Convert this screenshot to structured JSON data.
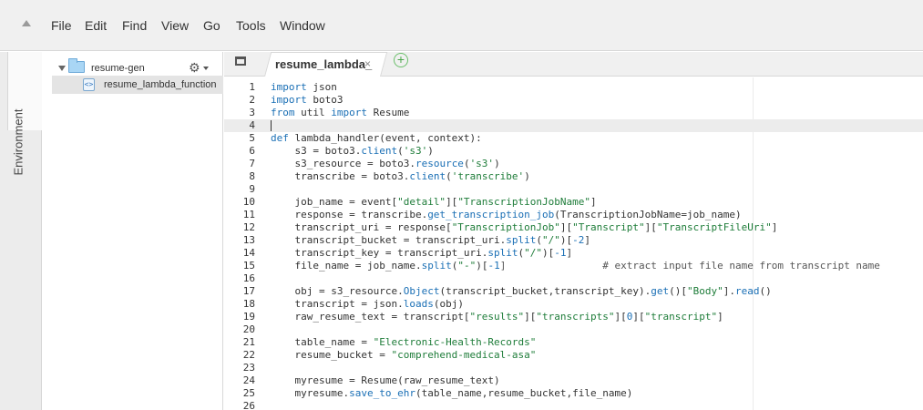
{
  "menu": {
    "items": [
      "File",
      "Edit",
      "Find",
      "View",
      "Go",
      "Tools",
      "Window"
    ]
  },
  "sidebar": {
    "environment_label": "Environment"
  },
  "tree": {
    "project_name": "resume-gen",
    "file_name": "resume_lambda_function"
  },
  "tabs": {
    "active_label": "resume_lambda_",
    "close_glyph": "×",
    "add_glyph": "+"
  },
  "editor": {
    "lines": [
      [
        {
          "t": "import",
          "c": "kw"
        },
        {
          "t": " json"
        }
      ],
      [
        {
          "t": "import",
          "c": "kw"
        },
        {
          "t": " boto3"
        }
      ],
      [
        {
          "t": "from",
          "c": "kw"
        },
        {
          "t": " util "
        },
        {
          "t": "import",
          "c": "kw"
        },
        {
          "t": " Resume"
        }
      ],
      [],
      [
        {
          "t": "def",
          "c": "kw"
        },
        {
          "t": " lambda_handler(event, context):"
        }
      ],
      [
        {
          "t": "    s3 = boto3."
        },
        {
          "t": "client",
          "c": "fn"
        },
        {
          "t": "("
        },
        {
          "t": "'s3'",
          "c": "str"
        },
        {
          "t": ")"
        }
      ],
      [
        {
          "t": "    s3_resource = boto3."
        },
        {
          "t": "resource",
          "c": "fn"
        },
        {
          "t": "("
        },
        {
          "t": "'s3'",
          "c": "str"
        },
        {
          "t": ")"
        }
      ],
      [
        {
          "t": "    transcribe = boto3."
        },
        {
          "t": "client",
          "c": "fn"
        },
        {
          "t": "("
        },
        {
          "t": "'transcribe'",
          "c": "str"
        },
        {
          "t": ")"
        }
      ],
      [],
      [
        {
          "t": "    job_name = event["
        },
        {
          "t": "\"detail\"",
          "c": "str"
        },
        {
          "t": "]["
        },
        {
          "t": "\"TranscriptionJobName\"",
          "c": "str"
        },
        {
          "t": "]"
        }
      ],
      [
        {
          "t": "    response = transcribe."
        },
        {
          "t": "get_transcription_job",
          "c": "fn"
        },
        {
          "t": "(TranscriptionJobName=job_name)"
        }
      ],
      [
        {
          "t": "    transcript_uri = response["
        },
        {
          "t": "\"TranscriptionJob\"",
          "c": "str"
        },
        {
          "t": "]["
        },
        {
          "t": "\"Transcript\"",
          "c": "str"
        },
        {
          "t": "]["
        },
        {
          "t": "\"TranscriptFileUri\"",
          "c": "str"
        },
        {
          "t": "]"
        }
      ],
      [
        {
          "t": "    transcript_bucket = transcript_uri."
        },
        {
          "t": "split",
          "c": "fn"
        },
        {
          "t": "("
        },
        {
          "t": "\"/\"",
          "c": "str"
        },
        {
          "t": ")["
        },
        {
          "t": "-2",
          "c": "kw"
        },
        {
          "t": "]"
        }
      ],
      [
        {
          "t": "    transcript_key = transcript_uri."
        },
        {
          "t": "split",
          "c": "fn"
        },
        {
          "t": "("
        },
        {
          "t": "\"/\"",
          "c": "str"
        },
        {
          "t": ")["
        },
        {
          "t": "-1",
          "c": "kw"
        },
        {
          "t": "]"
        }
      ],
      [
        {
          "t": "    file_name = job_name."
        },
        {
          "t": "split",
          "c": "fn"
        },
        {
          "t": "("
        },
        {
          "t": "\"-\"",
          "c": "str"
        },
        {
          "t": ")["
        },
        {
          "t": "-1",
          "c": "kw"
        },
        {
          "t": "]                # extract input file name from transcript name",
          "c": "cm"
        }
      ],
      [],
      [
        {
          "t": "    obj = s3_resource."
        },
        {
          "t": "Object",
          "c": "fn"
        },
        {
          "t": "(transcript_bucket,transcript_key)."
        },
        {
          "t": "get",
          "c": "fn"
        },
        {
          "t": "()["
        },
        {
          "t": "\"Body\"",
          "c": "str"
        },
        {
          "t": "]."
        },
        {
          "t": "read",
          "c": "fn"
        },
        {
          "t": "()"
        }
      ],
      [
        {
          "t": "    transcript = json."
        },
        {
          "t": "loads",
          "c": "fn"
        },
        {
          "t": "(obj)"
        }
      ],
      [
        {
          "t": "    raw_resume_text = transcript["
        },
        {
          "t": "\"results\"",
          "c": "str"
        },
        {
          "t": "]["
        },
        {
          "t": "\"transcripts\"",
          "c": "str"
        },
        {
          "t": "]["
        },
        {
          "t": "0",
          "c": "kw"
        },
        {
          "t": "]["
        },
        {
          "t": "\"transcript\"",
          "c": "str"
        },
        {
          "t": "]"
        }
      ],
      [],
      [
        {
          "t": "    table_name = "
        },
        {
          "t": "\"Electronic-Health-Records\"",
          "c": "str"
        }
      ],
      [
        {
          "t": "    resume_bucket = "
        },
        {
          "t": "\"comprehend-medical-asa\"",
          "c": "str"
        }
      ],
      [],
      [
        {
          "t": "    myresume = Resume(raw_resume_text)"
        }
      ],
      [
        {
          "t": "    myresume."
        },
        {
          "t": "save_to_ehr",
          "c": "fn"
        },
        {
          "t": "(table_name,resume_bucket,file_name)"
        }
      ],
      []
    ],
    "active_line": 4
  }
}
